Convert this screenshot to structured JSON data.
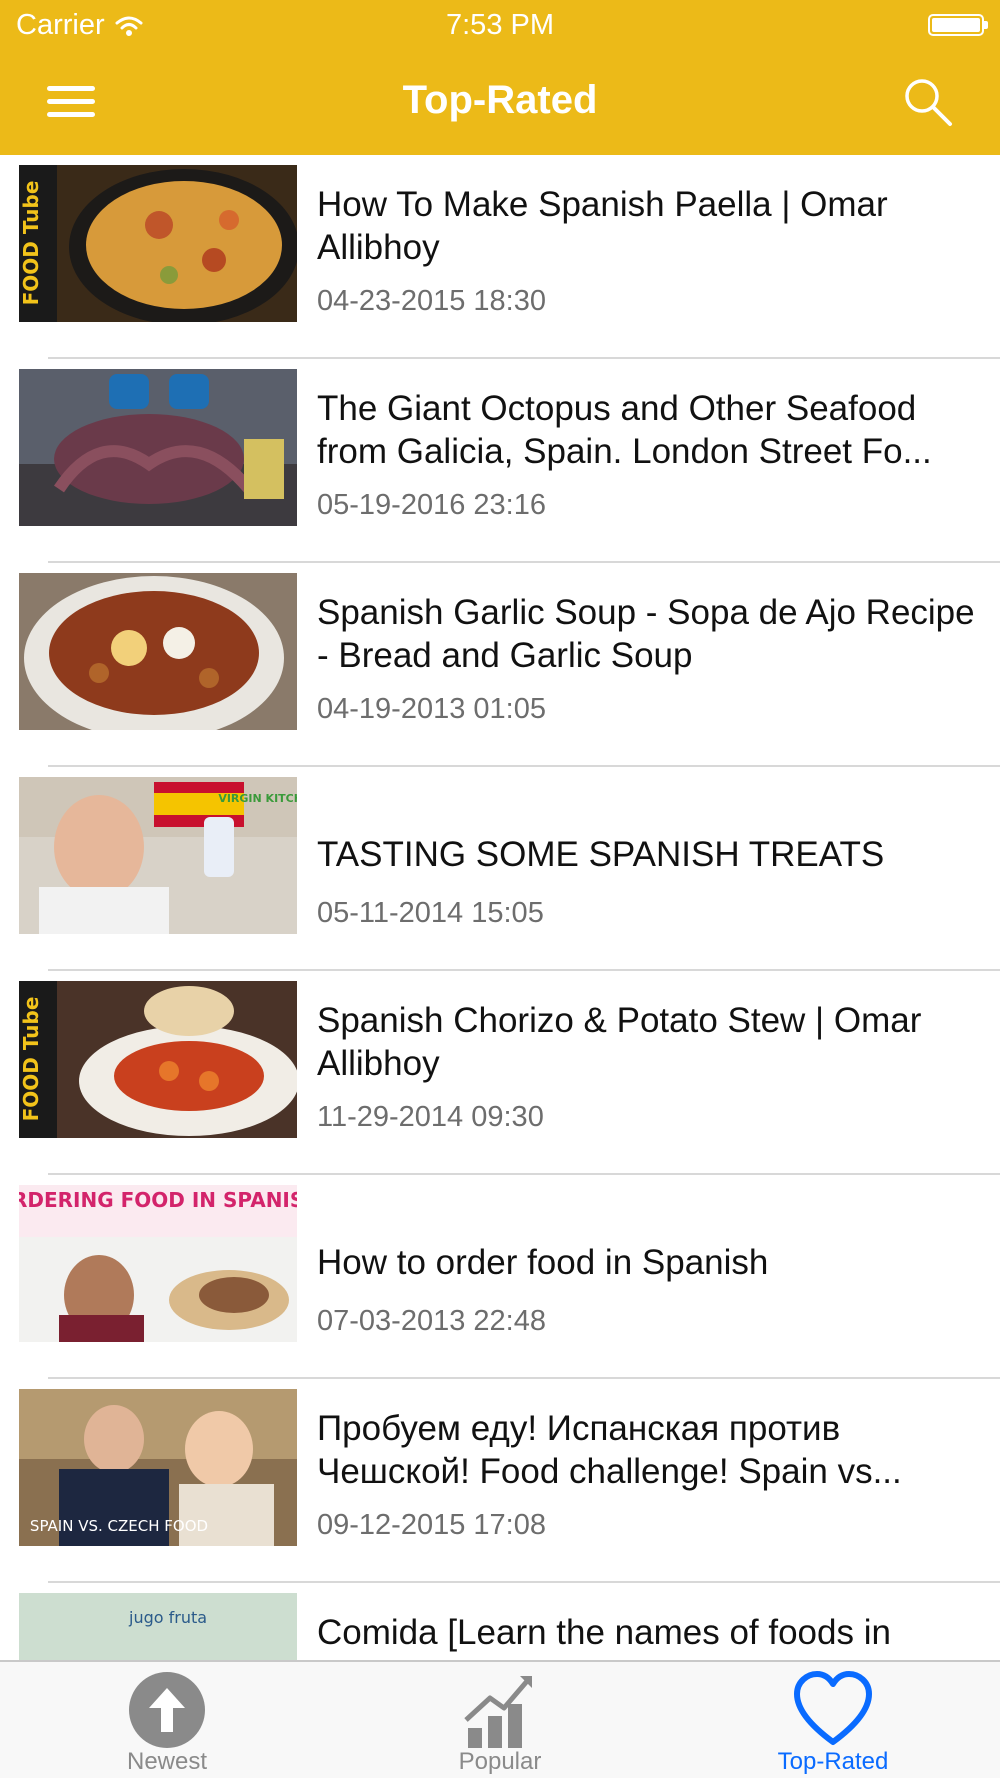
{
  "status_bar": {
    "carrier": "Carrier",
    "time": "7:53 PM"
  },
  "navbar": {
    "title": "Top-Rated",
    "menu_icon": "hamburger-menu-icon",
    "search_icon": "search-icon"
  },
  "videos": [
    {
      "title": "How To Make Spanish Paella | Omar Allibhoy",
      "date": "04-23-2015 18:30",
      "thumb_text": "FOOD Tube"
    },
    {
      "title": "The Giant Octopus and Other Seafood from Galicia, Spain. London Street Fo...",
      "date": "05-19-2016 23:16",
      "thumb_text": ""
    },
    {
      "title": "Spanish Garlic Soup - Sopa de Ajo Recipe - Bread and Garlic Soup",
      "date": "04-19-2013 01:05",
      "thumb_text": ""
    },
    {
      "title": "TASTING SOME SPANISH TREATS",
      "date": "05-11-2014 15:05",
      "thumb_text": "VIRGIN KITCHEN"
    },
    {
      "title": "Spanish Chorizo & Potato Stew | Omar Allibhoy",
      "date": "11-29-2014 09:30",
      "thumb_text": "FOOD Tube"
    },
    {
      "title": "How to order food in Spanish",
      "date": "07-03-2013 22:48",
      "thumb_text": "ORDERING FOOD IN SPANISH"
    },
    {
      "title": "Пробуем еду! Испанская против Чешской! Food challenge! Spain vs...",
      "date": "09-12-2015 17:08",
      "thumb_text": "SPAIN VS. CZECH FOOD"
    },
    {
      "title": "Comida [Learn the names of foods in",
      "date": "",
      "thumb_text": "jugo fruta"
    }
  ],
  "tabs": [
    {
      "label": "Newest",
      "icon": "upload-arrow-icon",
      "active": false
    },
    {
      "label": "Popular",
      "icon": "bar-chart-trend-icon",
      "active": false
    },
    {
      "label": "Top-Rated",
      "icon": "heart-icon",
      "active": true
    }
  ],
  "colors": {
    "accent": "#ECBA18",
    "active_tab": "#0A6BFF",
    "inactive_tab": "#8A8A8A"
  }
}
